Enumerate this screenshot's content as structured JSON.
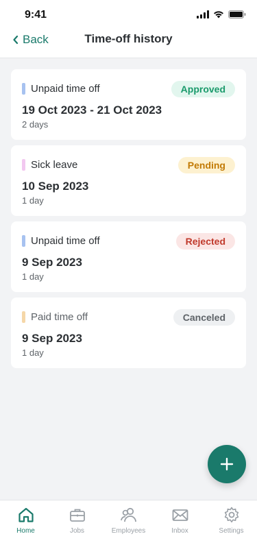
{
  "status_bar": {
    "time": "9:41"
  },
  "nav": {
    "back_label": "Back",
    "title": "Time-off history"
  },
  "requests": [
    {
      "type": "Unpaid time off",
      "type_color": "#a7c2f0",
      "status": "Approved",
      "status_fg": "#1a9a6b",
      "status_bg": "#e2f6ee",
      "dates": "19 Oct 2023 - 21 Oct 2023",
      "duration": "2 days"
    },
    {
      "type": "Sick leave",
      "type_color": "#f2c8f0",
      "status": "Pending",
      "status_fg": "#c27a05",
      "status_bg": "#fdf1d0",
      "dates": "10 Sep 2023",
      "duration": "1 day"
    },
    {
      "type": "Unpaid time off",
      "type_color": "#a7c2f0",
      "status": "Rejected",
      "status_fg": "#c0392b",
      "status_bg": "#fbe6e5",
      "dates": "9 Sep 2023",
      "duration": "1 day"
    },
    {
      "type": "Paid time off",
      "type_color": "#f5d7a8",
      "status": "Canceled",
      "status_fg": "#5e6368",
      "status_bg": "#eef0f2",
      "dates": "9 Sep 2023",
      "duration": "1 day"
    }
  ],
  "fab": {
    "icon": "plus-icon"
  },
  "tabs": [
    {
      "label": "Home",
      "icon": "home-icon",
      "active": true
    },
    {
      "label": "Jobs",
      "icon": "briefcase-icon",
      "active": false
    },
    {
      "label": "Employees",
      "icon": "people-icon",
      "active": false
    },
    {
      "label": "Inbox",
      "icon": "envelope-icon",
      "active": false
    },
    {
      "label": "Settings",
      "icon": "gear-icon",
      "active": false
    }
  ],
  "colors": {
    "accent": "#1a7a6b",
    "inactive": "#9aa0a6"
  }
}
